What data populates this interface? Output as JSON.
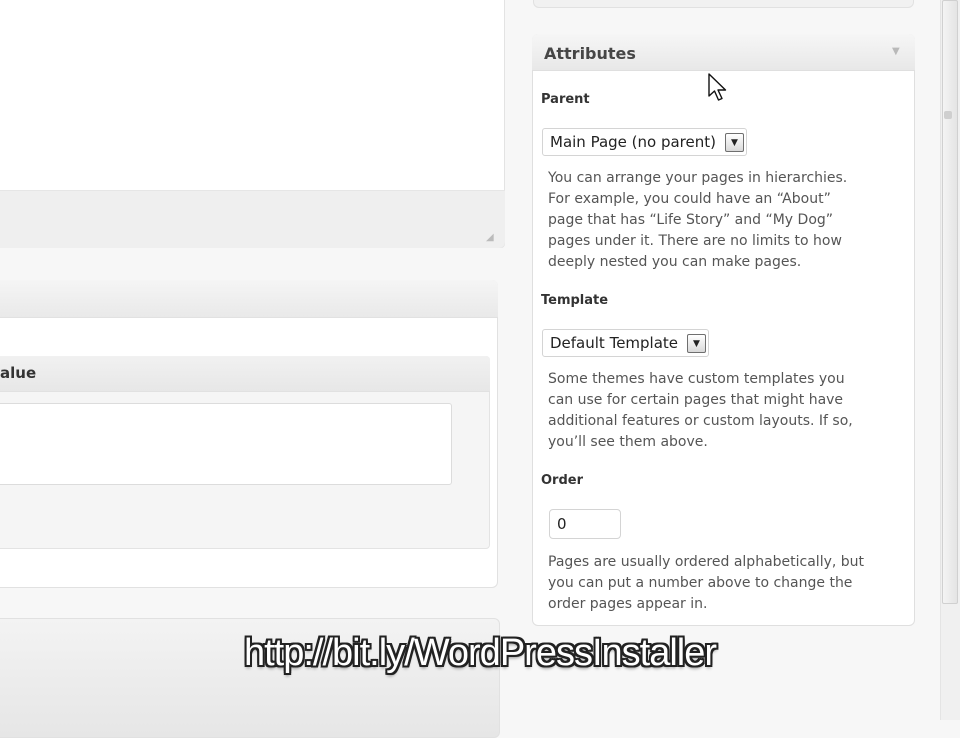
{
  "sidebar": {
    "attributes": {
      "title": "Attributes",
      "parent": {
        "label": "Parent",
        "selected": "Main Page (no parent)",
        "help_lines": [
          "You can arrange your pages in hierarchies.",
          "For example, you could have an “About”",
          "page that has “Life Story” and “My Dog”",
          "pages under it. There are no limits to how",
          "deeply nested you can make pages."
        ]
      },
      "template": {
        "label": "Template",
        "selected": "Default Template",
        "help_lines": [
          "Some themes have custom templates you",
          "can use for certain pages that might have",
          "additional features or custom layouts. If so,",
          "you’ll see them above."
        ]
      },
      "order": {
        "label": "Order",
        "value": "0",
        "help_lines": [
          "Pages are usually ordered alphabetically, but",
          "you can put a number above to change the",
          "order pages appear in."
        ]
      }
    }
  },
  "main": {
    "custom_fields": {
      "value_header": "alue"
    }
  },
  "overlay": {
    "url": "http://bit.ly/WordPressInstaller"
  },
  "icons": {
    "dropdown": "chevron-down-icon",
    "cursor": "mouse-pointer-icon",
    "resize": "resize-grip-icon",
    "toggle": "triangle-down-icon"
  }
}
